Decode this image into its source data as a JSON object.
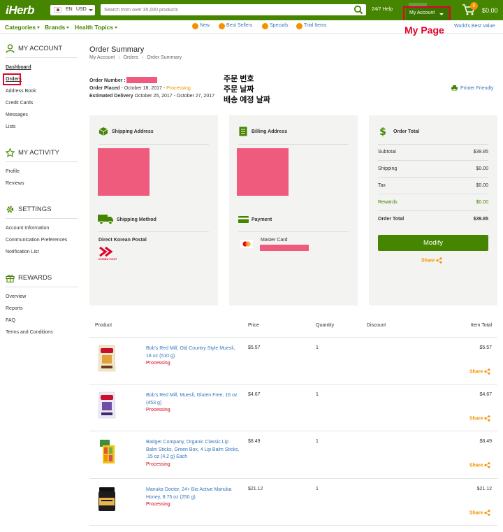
{
  "header": {
    "logo": "iHerb",
    "language": "EN",
    "currency": "USD",
    "search_placeholder": "Search from over 35,000 products",
    "help": "24/7 Help",
    "account_label": "My Account",
    "cart_count": "0",
    "cart_total": "$0.00"
  },
  "nav": {
    "categories": "Categories",
    "brands": "Brands",
    "health_topics": "Health Topics",
    "new": "New",
    "best_sellers": "Best Sellers",
    "specials": "Specials",
    "trial_items": "Trial Items",
    "worlds_best_value": "World's Best Value"
  },
  "annotations": {
    "my_page": "My Page",
    "order_number_kr": "주문 번호",
    "order_date_kr": "주문 날짜",
    "delivery_kr": "배송 예정 날짜"
  },
  "sidebar": {
    "my_account": {
      "title": "MY ACCOUNT",
      "items": [
        "Dashboard",
        "Orders",
        "Address Book",
        "Credit Cards",
        "Messages",
        "Lists"
      ]
    },
    "my_activity": {
      "title": "MY ACTIVITY",
      "items": [
        "Profile",
        "Reviews"
      ]
    },
    "settings": {
      "title": "SETTINGS",
      "items": [
        "Account Information",
        "Communication Preferences",
        "Notification List"
      ]
    },
    "rewards": {
      "title": "REWARDS",
      "items": [
        "Overview",
        "Reports",
        "FAQ",
        "Terms and Conditions"
      ]
    }
  },
  "order": {
    "title": "Order Summary",
    "breadcrumb": [
      "My Account",
      "Orders",
      "Order Summary"
    ],
    "number_label": "Order Number :",
    "placed_label": "Order Placed",
    "placed_value": " - October 18, 2017 - ",
    "status": "Processing",
    "delivery_label": "Estimated Delivery",
    "delivery_value": " October 25, 2017 - October 27, 2017",
    "printer_friendly": "Printer Friendly"
  },
  "panels": {
    "shipping_address": "Shipping Address",
    "shipping_method": "Shipping Method",
    "shipping_method_value": "Direct Korean Postal",
    "korea_post": "KOREA POST",
    "billing_address": "Billing Address",
    "payment": "Payment",
    "payment_value": "Master Card",
    "order_total": "Order Total",
    "totals": [
      {
        "label": "Subtotal",
        "value": "$39.85"
      },
      {
        "label": "Shipping",
        "value": "$0.00"
      },
      {
        "label": "Tax",
        "value": "$0.00"
      },
      {
        "label": "Rewards",
        "value": "$0.00"
      },
      {
        "label": "Order Total",
        "value": "$39.85"
      }
    ],
    "modify": "Modify",
    "share": "Share"
  },
  "table": {
    "headers": {
      "product": "Product",
      "price": "Price",
      "quantity": "Quantity",
      "discount": "Discount",
      "item_total": "Item Total"
    },
    "rows": [
      {
        "name": "Bob's Red Mill, Old Country Style Muesli, 18 oz (510 g)",
        "status": "Processing",
        "price": "$5.57",
        "qty": "1",
        "total": "$5.57",
        "share": "Share"
      },
      {
        "name": "Bob's Red Mill, Muesli, Gluten Free, 16 oz (453 g)",
        "status": "Processing",
        "price": "$4.67",
        "qty": "1",
        "total": "$4.67",
        "share": "Share"
      },
      {
        "name": "Badger Company, Organic Classic Lip Balm Sticks, Green Box, 4 Lip Balm Sticks, .15 oz (4.2 g) Each",
        "status": "Processing",
        "price": "$8.49",
        "qty": "1",
        "total": "$8.49",
        "share": "Share"
      },
      {
        "name": "Manuka Doctor, 24+ Bio Active Manuka Honey, 8.75 oz (250 g)",
        "status": "Processing",
        "price": "$21.12",
        "qty": "1",
        "total": "$21.12",
        "share": "Share"
      }
    ]
  },
  "colors": {
    "brand_green": "#458500",
    "link_blue": "#3575b8",
    "orange": "#f39200",
    "status_red": "#d0021b",
    "annotation_red": "#e4002b",
    "redaction_pink": "#ee5b7c"
  }
}
